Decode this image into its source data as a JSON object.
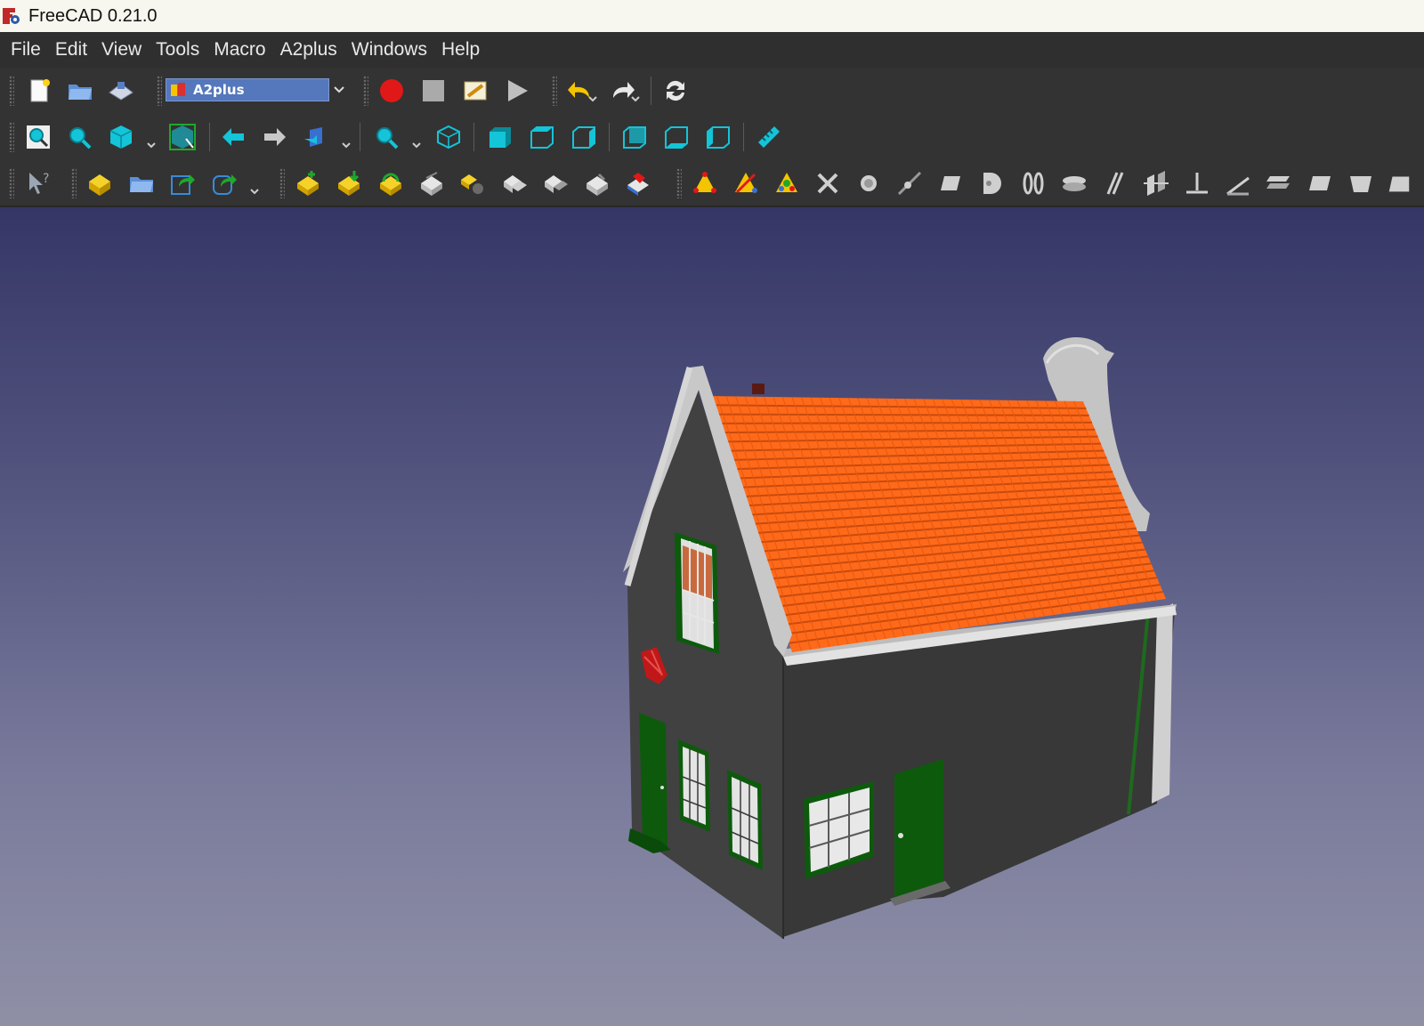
{
  "window": {
    "title": "FreeCAD 0.21.0",
    "logo_icon": "freecad-logo-icon"
  },
  "menubar": {
    "items": [
      "File",
      "Edit",
      "View",
      "Tools",
      "Macro",
      "A2plus",
      "Windows",
      "Help"
    ]
  },
  "toolbar_file": {
    "workbench_selector": {
      "value": "A2plus",
      "icon": "a2plus-workbench-icon"
    }
  },
  "colors": {
    "background_top": "#353666",
    "background_bottom": "#8f90a6",
    "roof": "#ff6a1a",
    "walls": "#3c3c3c",
    "trim": "#c8c8c8",
    "window_frames": "#0d5a0d",
    "accent_cyan": "#14c4d8",
    "accent_yellow": "#f5c400"
  }
}
